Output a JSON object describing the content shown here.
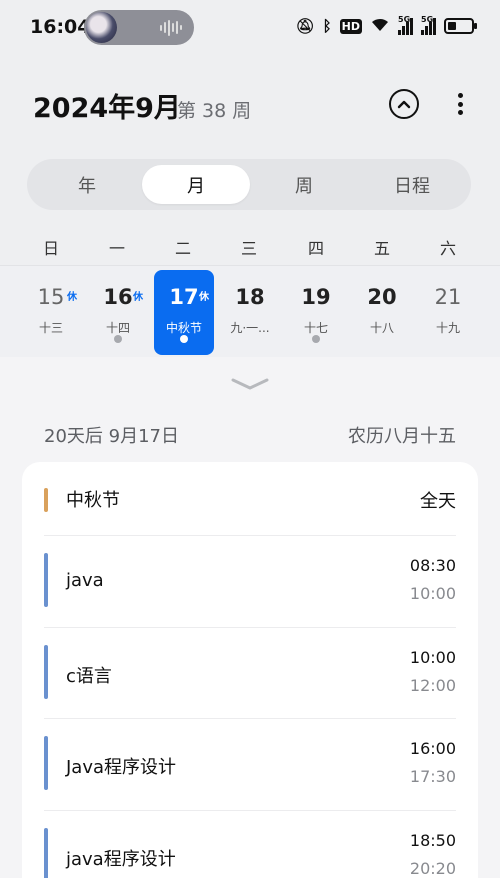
{
  "status_bar": {
    "time": "16:04",
    "hd_label": "HD",
    "net1": "5G",
    "net2": "5G",
    "battery_level": 0.35
  },
  "header": {
    "title": "2024年9月",
    "week": "第 38 周"
  },
  "tabs": [
    {
      "label": "年",
      "active": false
    },
    {
      "label": "月",
      "active": true
    },
    {
      "label": "周",
      "active": false
    },
    {
      "label": "日程",
      "active": false
    }
  ],
  "weekdays": [
    "日",
    "一",
    "二",
    "三",
    "四",
    "五",
    "六"
  ],
  "days": [
    {
      "num": "15",
      "rest": "休",
      "lunar": "十三",
      "dot": false,
      "dim": true
    },
    {
      "num": "16",
      "rest": "休",
      "lunar": "十四",
      "dot": true,
      "dim": false
    },
    {
      "num": "17",
      "rest": "休",
      "lunar": "中秋节",
      "dot": true,
      "dim": false,
      "selected": true
    },
    {
      "num": "18",
      "rest": "",
      "lunar": "九·一...",
      "dot": false,
      "dim": false
    },
    {
      "num": "19",
      "rest": "",
      "lunar": "十七",
      "dot": true,
      "dim": false
    },
    {
      "num": "20",
      "rest": "",
      "lunar": "十八",
      "dot": false,
      "dim": false
    },
    {
      "num": "21",
      "rest": "",
      "lunar": "十九",
      "dot": false,
      "dim": true
    }
  ],
  "selected_info": {
    "relative": "20天后  9月17日",
    "lunar": "农历八月十五"
  },
  "events": [
    {
      "title": "中秋节",
      "all_day": "全天",
      "color": "#d9a15c"
    },
    {
      "title": "java",
      "start": "08:30",
      "end": "10:00",
      "color": "#6a91cf"
    },
    {
      "title": "c语言",
      "start": "10:00",
      "end": "12:00",
      "color": "#6a91cf"
    },
    {
      "title": "Java程序设计",
      "start": "16:00",
      "end": "17:30",
      "color": "#6a91cf"
    },
    {
      "title": "java程序设计",
      "start": "18:50",
      "end": "20:20",
      "color": "#6a91cf"
    }
  ]
}
